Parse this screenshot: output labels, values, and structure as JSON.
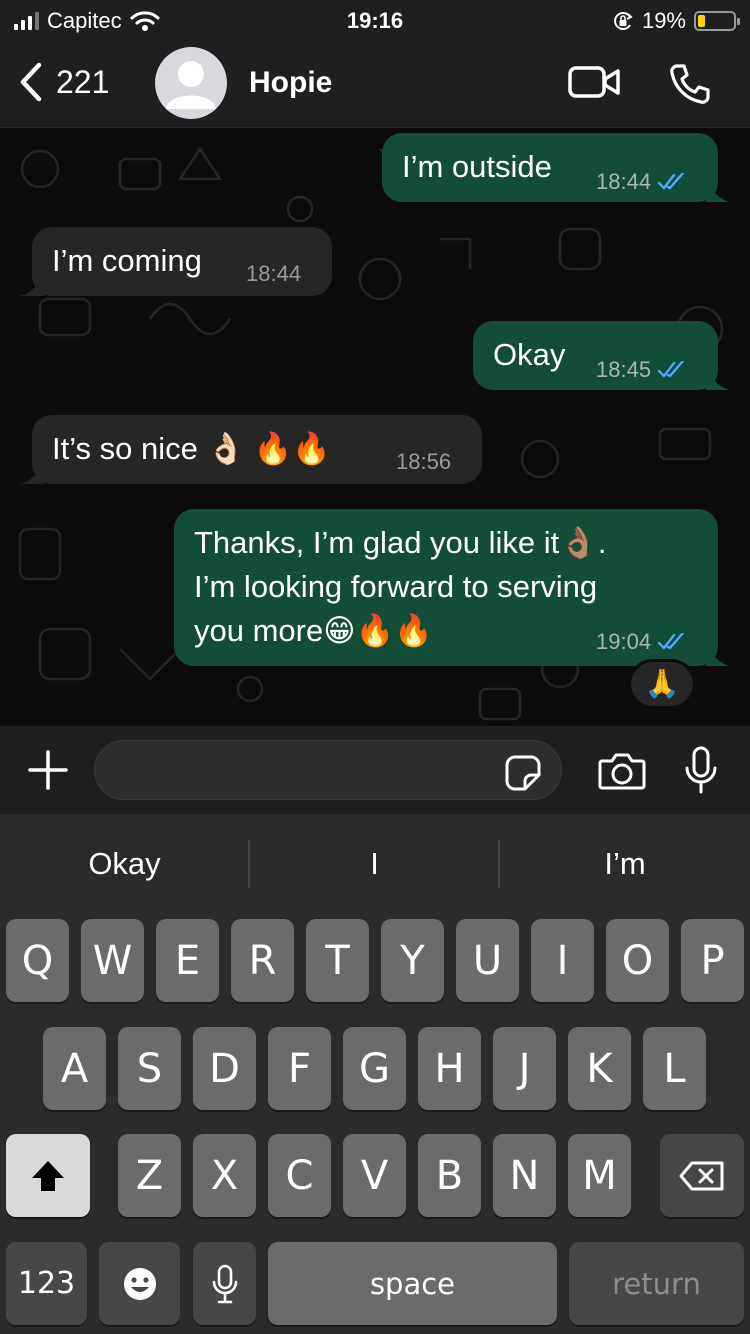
{
  "status_bar": {
    "carrier": "Capitec",
    "time": "19:16",
    "battery_percent": "19%",
    "battery_level": 0.19,
    "icons": [
      "signal-icon",
      "wifi-icon",
      "orientation-lock-icon",
      "battery-icon"
    ]
  },
  "header": {
    "back_count": "221",
    "contact_name": "Hopie",
    "icons": [
      "chevron-left-icon",
      "avatar-placeholder",
      "video-call-icon",
      "phone-icon"
    ]
  },
  "messages": [
    {
      "direction": "outgoing",
      "text": "I’m outside",
      "time": "18:44",
      "status": "read"
    },
    {
      "direction": "incoming",
      "text": "I’m coming",
      "time": "18:44"
    },
    {
      "direction": "outgoing",
      "text": "Okay",
      "time": "18:45",
      "status": "read"
    },
    {
      "direction": "incoming",
      "text": "It’s so nice 👌🏻 🔥🔥",
      "time": "18:56"
    },
    {
      "direction": "outgoing",
      "lines": [
        "Thanks, I’m glad you like it👌🏽.",
        "I’m  looking forward to serving",
        "you more😁🔥🔥"
      ],
      "time": "19:04",
      "status": "read",
      "reaction": "🙏"
    }
  ],
  "composer": {
    "placeholder": "",
    "icons": [
      "plus-icon",
      "sticker-icon",
      "camera-icon",
      "microphone-icon"
    ]
  },
  "keyboard": {
    "suggestions": [
      "Okay",
      "I",
      "I’m"
    ],
    "row1": [
      "Q",
      "W",
      "E",
      "R",
      "T",
      "Y",
      "U",
      "I",
      "O",
      "P"
    ],
    "row2": [
      "A",
      "S",
      "D",
      "F",
      "G",
      "H",
      "J",
      "K",
      "L"
    ],
    "row3": [
      "Z",
      "X",
      "C",
      "V",
      "B",
      "N",
      "M"
    ],
    "numbers_label": "123",
    "space_label": "space",
    "return_label": "return",
    "icons": [
      "shift-icon",
      "backspace-icon",
      "emoji-icon",
      "dictation-mic-icon"
    ]
  },
  "colors": {
    "outgoing_bubble": "#144d37",
    "incoming_bubble": "#262626",
    "read_ticks": "#53a6fd",
    "battery_low": "#ffd60a"
  }
}
